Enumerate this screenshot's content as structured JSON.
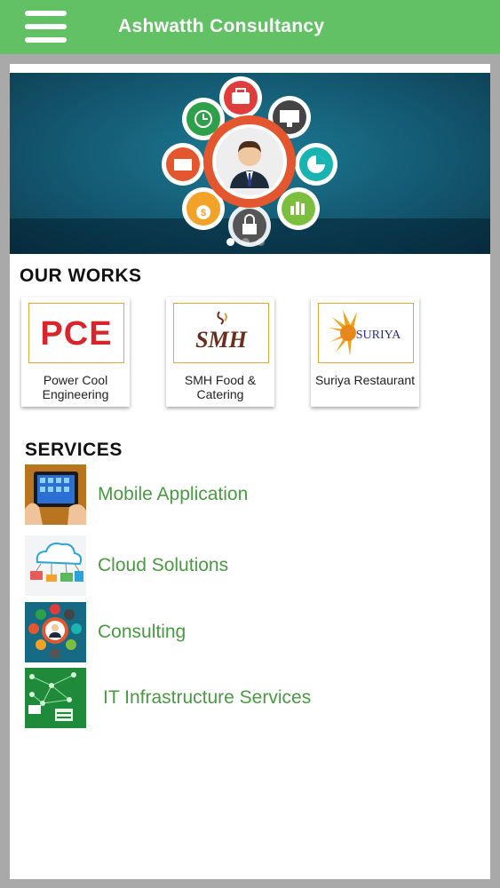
{
  "appbar": {
    "title": "Ashwatth Consultancy",
    "menu_icon": "hamburger-menu-icon"
  },
  "banner": {
    "slide_count": 3,
    "active_slide": 1
  },
  "works": {
    "heading": "OUR WORKS",
    "items": [
      {
        "label": "Power Cool Engineering",
        "logo_text": "PCE"
      },
      {
        "label": "SMH Food & Catering",
        "logo_text": "SMH"
      },
      {
        "label": "Suriya Restaurant",
        "logo_text": "SURIYA"
      }
    ]
  },
  "services": {
    "heading": "SERVICES",
    "items": [
      {
        "label": "Mobile Application",
        "icon": "tablet-apps-icon"
      },
      {
        "label": "Cloud Solutions",
        "icon": "cloud-icon"
      },
      {
        "label": "Consulting",
        "icon": "consultant-icon"
      },
      {
        "label": "IT Infrastructure Services",
        "icon": "network-icon"
      }
    ]
  },
  "colors": {
    "appbar": "#63c165",
    "service_text": "#4a9a43",
    "logo_border": "#e3a636",
    "pce_red": "#d8242b"
  }
}
